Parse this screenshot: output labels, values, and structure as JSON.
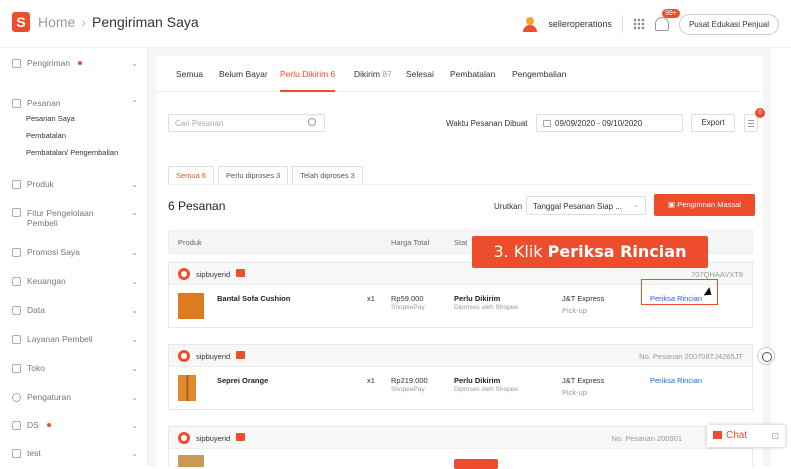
{
  "topbar": {
    "home": "Home",
    "separator": "›",
    "current": "Pengiriman Saya",
    "username": "selleroperations",
    "notif_badge": "99+",
    "edu_button": "Pusat Edukasi Penjual"
  },
  "sidebar": {
    "items": [
      {
        "label": "Pengiriman",
        "dot": true,
        "chev": "⌄"
      },
      {
        "label": "Pesanan",
        "chev": "⌃"
      },
      {
        "label": "Produk",
        "chev": "⌄"
      },
      {
        "label": "Fitur Pengelolaan Pembeli",
        "chev": "⌄"
      },
      {
        "label": "Promosi Saya",
        "chev": "⌄"
      },
      {
        "label": "Keuangan",
        "chev": "⌄"
      },
      {
        "label": "Data",
        "chev": "⌄"
      },
      {
        "label": "Layanan Pembeli",
        "chev": "⌄"
      },
      {
        "label": "Toko",
        "chev": "⌄"
      },
      {
        "label": "Pengaturan",
        "chev": "⌄"
      },
      {
        "label": "DS",
        "dot": true,
        "chev": "⌄"
      },
      {
        "label": "test",
        "chev": "⌄"
      }
    ],
    "subitems": [
      "Pesanan Saya",
      "Pembatalan",
      "Pembatalan/ Pengembalian"
    ]
  },
  "tabs": [
    {
      "label": "Semua",
      "count": ""
    },
    {
      "label": "Belum Bayar",
      "count": ""
    },
    {
      "label": "Perlu Dikirim",
      "count": "6"
    },
    {
      "label": "Dikirim",
      "count": "87"
    },
    {
      "label": "Selesai",
      "count": ""
    },
    {
      "label": "Pembatalan",
      "count": ""
    },
    {
      "label": "Pengembalian",
      "count": ""
    }
  ],
  "filters": {
    "search_placeholder": "Cari Pesanan",
    "date_label": "Waktu Pesanan Dibuat",
    "date_range": "09/09/2020 - 09/10/2020",
    "export": "Export",
    "doc_badge": "0"
  },
  "subtabs": [
    "Semua 6",
    "Perlu diproses 3",
    "Telah diproses 3"
  ],
  "list": {
    "count": "6 Pesanan",
    "sort_label": "Urutkan",
    "sort_value": "Tanggal Pesanan Siap ...",
    "massal": "Pengiriman Massal"
  },
  "table_headers": [
    "Produk",
    "Harga Total",
    "Stat"
  ],
  "orders": [
    {
      "buyer": "sipbuyerid",
      "order_no": "707QHAAVXT8",
      "product": "Bantal Sofa Cushion",
      "qty": "x1",
      "price": "Rp59.000",
      "payment": "ShopeePay",
      "status": "Perlu Dikirim",
      "status_sub": "Diproses oleh Shopee",
      "courier": "J&T Express",
      "method": "Pick-up",
      "action": "Periksa Rincian"
    },
    {
      "buyer": "sipbuyerid",
      "order_no": "No. Pesanan 200708TJ4265JT",
      "product": "Seprei Orange",
      "qty": "x1",
      "price": "Rp219.000",
      "payment": "ShopeePay",
      "status": "Perlu Dikirim",
      "status_sub": "Diproses oleh Shopee",
      "courier": "J&T Express",
      "method": "Pick-up",
      "action": "Periksa Rincian"
    },
    {
      "buyer": "sipbuyerid",
      "order_no": "No. Pesanan 200901",
      "product": "",
      "qty": "",
      "price": "",
      "payment": "",
      "status": "",
      "status_sub": "",
      "courier": "",
      "method": "",
      "action": ""
    }
  ],
  "callout": {
    "prefix": "3. Klik ",
    "bold": "Periksa Rincian"
  },
  "chat": {
    "label": "Chat"
  },
  "colors": {
    "accent": "#ee4d2d",
    "link": "#1f68d6"
  }
}
